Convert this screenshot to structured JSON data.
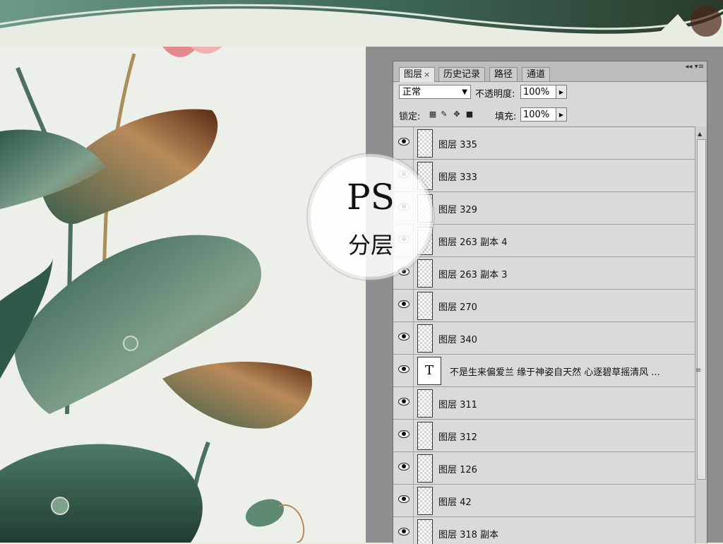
{
  "panel": {
    "tabs": [
      {
        "label": "图层",
        "close": "×"
      },
      {
        "label": "历史记录"
      },
      {
        "label": "路径"
      },
      {
        "label": "通道"
      }
    ],
    "menu_icon": "◂◂ ▾≡",
    "blend_mode": "正常",
    "opacity_label": "不透明度:",
    "opacity_value": "100%",
    "lock_label": "锁定:",
    "fill_label": "填充:",
    "fill_value": "100%",
    "layers": [
      {
        "name": "图层 335",
        "visible": true,
        "type": "raster"
      },
      {
        "name": "图层 333",
        "visible": true,
        "type": "raster"
      },
      {
        "name": "图层 329",
        "visible": true,
        "type": "raster"
      },
      {
        "name": "图层 263 副本 4",
        "visible": true,
        "type": "raster"
      },
      {
        "name": "图层 263 副本 3",
        "visible": true,
        "type": "raster"
      },
      {
        "name": "图层 270",
        "visible": true,
        "type": "raster"
      },
      {
        "name": "图层 340",
        "visible": true,
        "type": "raster"
      },
      {
        "name": "不是生来偏爱兰 缘于神姿自天然 心逐碧草摇清风 ...",
        "visible": true,
        "type": "text",
        "glyph": "T"
      },
      {
        "name": "图层 311",
        "visible": true,
        "type": "raster"
      },
      {
        "name": "图层 312",
        "visible": true,
        "type": "raster"
      },
      {
        "name": "图层 126",
        "visible": true,
        "type": "raster"
      },
      {
        "name": "图层 42",
        "visible": true,
        "type": "raster"
      },
      {
        "name": "图层 318 副本",
        "visible": true,
        "type": "raster"
      }
    ]
  },
  "overlay": {
    "big": "PS",
    "small": "分层"
  },
  "colors": {
    "leaf_green": "#3f6a55",
    "leaf_brown": "#8a5a2c",
    "background": "#edf0e8"
  }
}
